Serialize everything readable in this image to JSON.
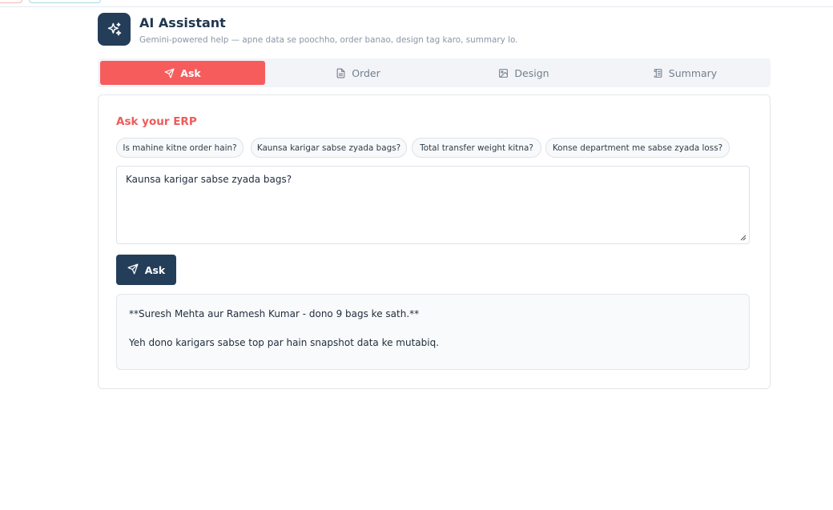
{
  "header": {
    "title": "AI Assistant",
    "subtitle": "Gemini-powered help — apne data se poochho, order banao, design tag karo, summary lo.",
    "logo_icon": "sparkles-icon"
  },
  "tabs": [
    {
      "label": "Ask",
      "icon": "send-icon",
      "active": true
    },
    {
      "label": "Order",
      "icon": "document-icon",
      "active": false
    },
    {
      "label": "Design",
      "icon": "image-icon",
      "active": false
    },
    {
      "label": "Summary",
      "icon": "scroll-icon",
      "active": false
    }
  ],
  "ask": {
    "section_title": "Ask your ERP",
    "suggestions": [
      "Is mahine kitne order hain?",
      "Kaunsa karigar sabse zyada bags?",
      "Total transfer weight kitna?",
      "Konse department me sabse zyada loss?"
    ],
    "question_value": "Kaunsa karigar sabse zyada bags?",
    "ask_button_label": "Ask",
    "answer_lines": [
      "**Suresh Mehta aur Ramesh Kumar - dono 9 bags ke sath.**",
      "Yeh dono karigars sabse top par hain snapshot data ke mutabiq."
    ]
  },
  "colors": {
    "primary": "#243e5a",
    "accent": "#f65c5c",
    "muted_text": "#8a96a6"
  }
}
